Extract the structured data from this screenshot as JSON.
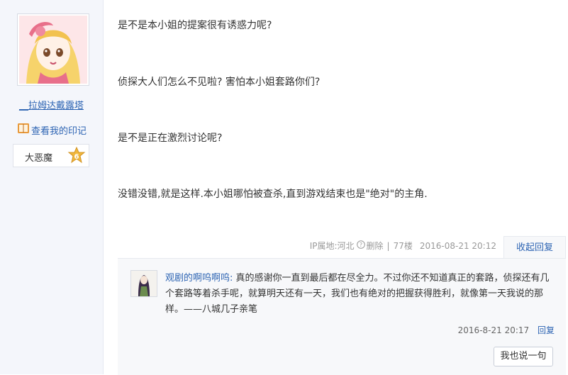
{
  "sidebar": {
    "username": "__拉姆达戴露塔",
    "imprint_label": "查看我的印记",
    "rank_name": "大恶魔",
    "rank_level": "6"
  },
  "post": {
    "paragraphs": [
      "是不是本小姐的提案很有诱惑力呢?",
      "侦探大人们怎么不见啦? 害怕本小姐套路你们?",
      "是不是正在激烈讨论呢?",
      "没错没错,就是这样.本小姐哪怕被查杀,直到游戏结束也是\"绝对\"的主角."
    ],
    "ip_location": "IP属地:河北",
    "delete_label": "删除",
    "floor": "77楼",
    "timestamp": "2016-08-21 20:12",
    "collapse_label": "收起回复"
  },
  "reply": {
    "user": "观剧的啊呜啊呜:",
    "text": "真的感谢你一直到最后都在尽全力。不过你还不知道真正的套路，侦探还有几个套路等着杀手呢，就算明天还有一天，我们也有绝对的把握获得胜利，就像第一天我说的那样。——八城几子亲笔",
    "timestamp": "2016-8-21 20:17",
    "reply_label": "回复",
    "say_button": "我也说一句"
  },
  "colors": {
    "link": "#2d64b3",
    "sidebar_bg": "#f4f6fb",
    "reply_bg": "#f7f8fa",
    "badge": "#f0b73b"
  },
  "icons": [
    "book-icon",
    "help-circle-icon",
    "star-badge-icon"
  ]
}
